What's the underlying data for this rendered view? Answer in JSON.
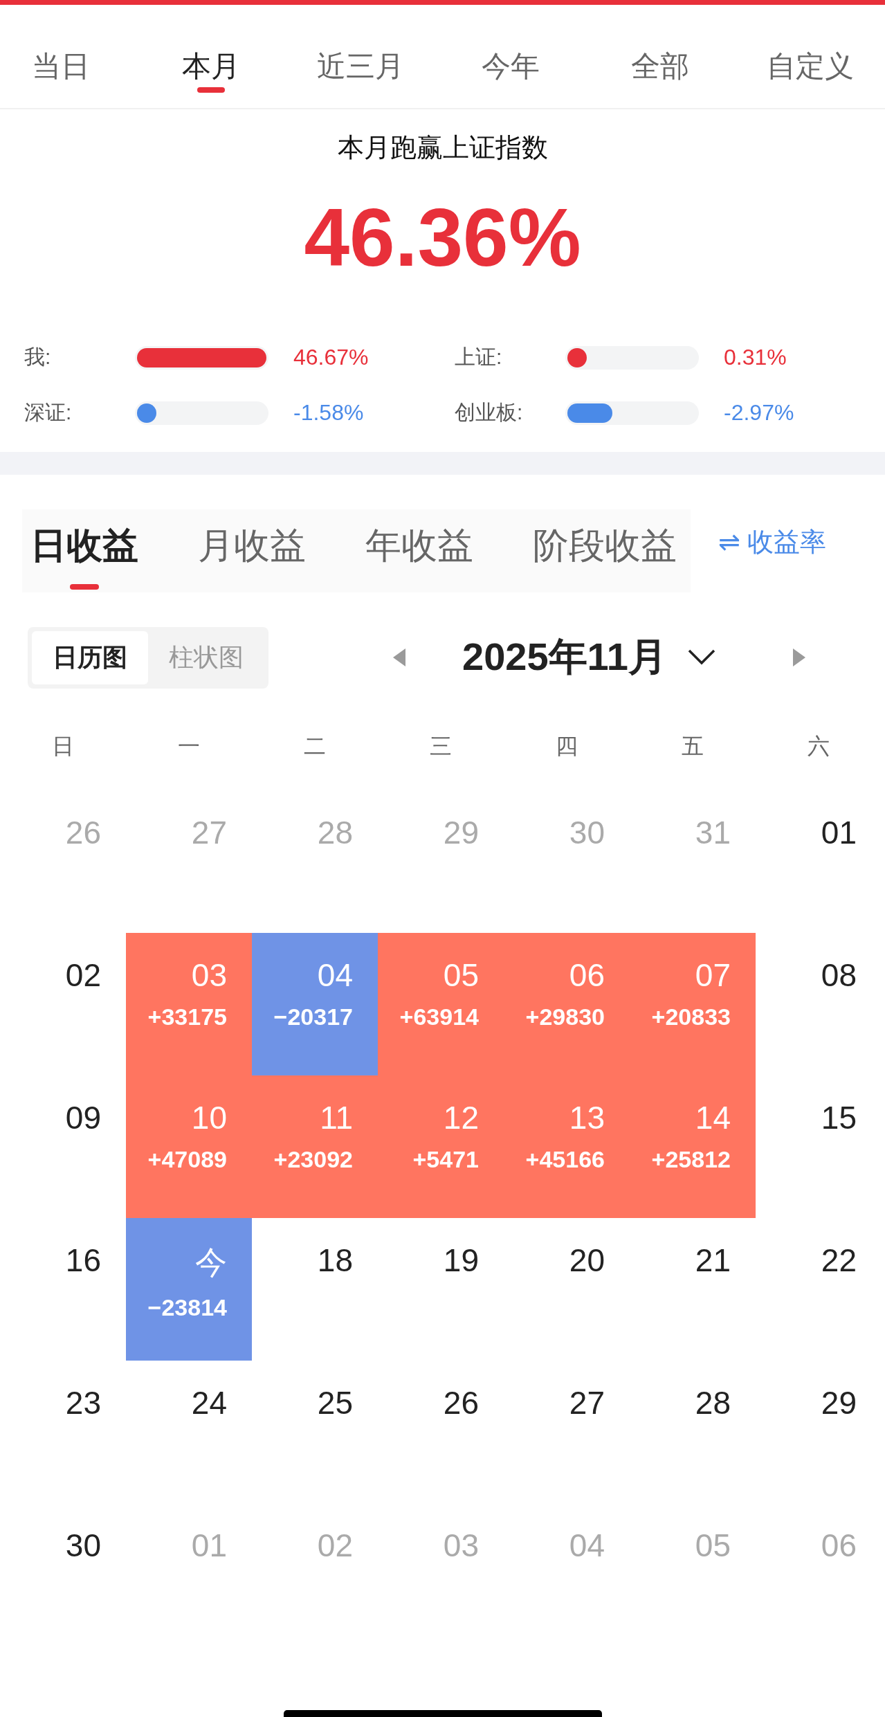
{
  "period_tabs": [
    {
      "label": "当日",
      "selected": false
    },
    {
      "label": "本月",
      "selected": true
    },
    {
      "label": "近三月",
      "selected": false
    },
    {
      "label": "今年",
      "selected": false
    },
    {
      "label": "全部",
      "selected": false
    },
    {
      "label": "自定义",
      "selected": false
    }
  ],
  "summary": {
    "title": "本月跑赢上证指数",
    "value": "46.36%"
  },
  "comparison": [
    {
      "label": "我:",
      "value": "46.67%",
      "level": 1.0,
      "color": "#e8303a"
    },
    {
      "label": "上证:",
      "value": "0.31%",
      "level": 0.15,
      "color": "#e8303a"
    },
    {
      "label": "深证:",
      "value": "-1.58%",
      "level": 0.15,
      "color": "#4a8ae8"
    },
    {
      "label": "创业板:",
      "value": "-2.97%",
      "level": 0.35,
      "color": "#4a8ae8"
    }
  ],
  "profit_tabs": [
    {
      "label": "日收益",
      "selected": true
    },
    {
      "label": "月收益",
      "selected": false
    },
    {
      "label": "年收益",
      "selected": false
    },
    {
      "label": "阶段收益",
      "selected": false
    }
  ],
  "switch_link": {
    "icon": "⇌",
    "label": "收益率"
  },
  "view_toggle": [
    {
      "label": "日历图",
      "selected": true
    },
    {
      "label": "柱状图",
      "selected": false
    }
  ],
  "month": "2025年11月",
  "weekdays": [
    "日",
    "一",
    "二",
    "三",
    "四",
    "五",
    "六"
  ],
  "weeks": [
    [
      {
        "day": "26",
        "outside_month": true,
        "kind": "plain"
      },
      {
        "day": "27",
        "outside_month": true,
        "kind": "plain"
      },
      {
        "day": "28",
        "outside_month": true,
        "kind": "plain"
      },
      {
        "day": "29",
        "outside_month": true,
        "kind": "plain"
      },
      {
        "day": "30",
        "outside_month": true,
        "kind": "plain"
      },
      {
        "day": "31",
        "outside_month": true,
        "kind": "plain"
      },
      {
        "day": "01",
        "outside_month": false,
        "kind": "plain"
      }
    ],
    [
      {
        "day": "02",
        "outside_month": false,
        "kind": "plain"
      },
      {
        "day": "03",
        "outside_month": false,
        "kind": "gain",
        "value": "+33175"
      },
      {
        "day": "04",
        "outside_month": false,
        "kind": "loss",
        "value": "−20317"
      },
      {
        "day": "05",
        "outside_month": false,
        "kind": "gain",
        "value": "+63914"
      },
      {
        "day": "06",
        "outside_month": false,
        "kind": "gain",
        "value": "+29830"
      },
      {
        "day": "07",
        "outside_month": false,
        "kind": "gain",
        "value": "+20833"
      },
      {
        "day": "08",
        "outside_month": false,
        "kind": "plain"
      }
    ],
    [
      {
        "day": "09",
        "outside_month": false,
        "kind": "plain"
      },
      {
        "day": "10",
        "outside_month": false,
        "kind": "gain",
        "value": "+47089"
      },
      {
        "day": "11",
        "outside_month": false,
        "kind": "gain",
        "value": "+23092"
      },
      {
        "day": "12",
        "outside_month": false,
        "kind": "gain",
        "value": "+5471"
      },
      {
        "day": "13",
        "outside_month": false,
        "kind": "gain",
        "value": "+45166"
      },
      {
        "day": "14",
        "outside_month": false,
        "kind": "gain",
        "value": "+25812"
      },
      {
        "day": "15",
        "outside_month": false,
        "kind": "plain"
      }
    ],
    [
      {
        "day": "16",
        "outside_month": false,
        "kind": "plain"
      },
      {
        "day": "今",
        "outside_month": false,
        "kind": "loss",
        "value": "−23814"
      },
      {
        "day": "18",
        "outside_month": false,
        "kind": "plain"
      },
      {
        "day": "19",
        "outside_month": false,
        "kind": "plain"
      },
      {
        "day": "20",
        "outside_month": false,
        "kind": "plain"
      },
      {
        "day": "21",
        "outside_month": false,
        "kind": "plain"
      },
      {
        "day": "22",
        "outside_month": false,
        "kind": "plain"
      }
    ],
    [
      {
        "day": "23",
        "outside_month": false,
        "kind": "plain"
      },
      {
        "day": "24",
        "outside_month": false,
        "kind": "plain"
      },
      {
        "day": "25",
        "outside_month": false,
        "kind": "plain"
      },
      {
        "day": "26",
        "outside_month": false,
        "kind": "plain"
      },
      {
        "day": "27",
        "outside_month": false,
        "kind": "plain"
      },
      {
        "day": "28",
        "outside_month": false,
        "kind": "plain"
      },
      {
        "day": "29",
        "outside_month": false,
        "kind": "plain"
      }
    ],
    [
      {
        "day": "30",
        "outside_month": false,
        "kind": "plain"
      },
      {
        "day": "01",
        "outside_month": true,
        "kind": "plain"
      },
      {
        "day": "02",
        "outside_month": true,
        "kind": "plain"
      },
      {
        "day": "03",
        "outside_month": true,
        "kind": "plain"
      },
      {
        "day": "04",
        "outside_month": true,
        "kind": "plain"
      },
      {
        "day": "05",
        "outside_month": true,
        "kind": "plain"
      },
      {
        "day": "06",
        "outside_month": true,
        "kind": "plain"
      }
    ]
  ]
}
